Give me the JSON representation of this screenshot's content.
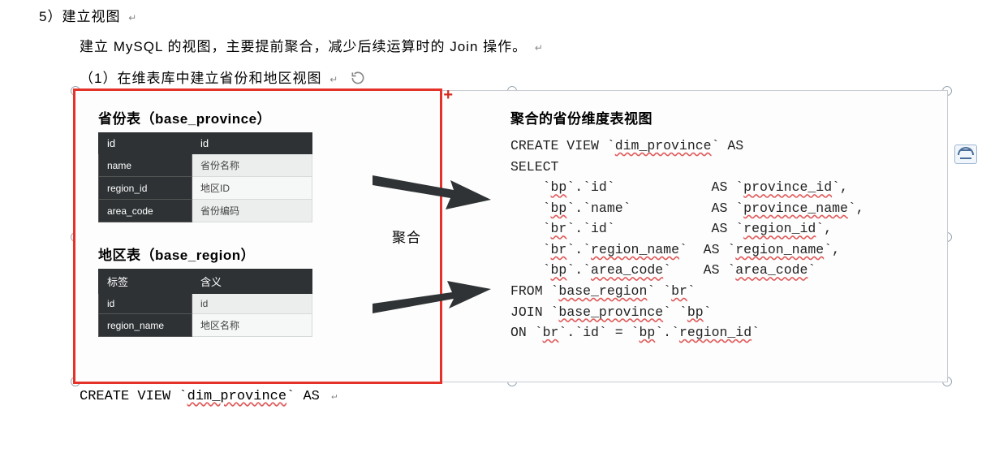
{
  "heading": "5）建立视图",
  "paragraph": "建立 MySQL 的视图，主要提前聚合，减少后续运算时的 Join 操作。",
  "subheading": "（1）在维表库中建立省份和地区视图",
  "left": {
    "table1": {
      "title_prefix": "省份表",
      "title_paren": "（base_province）",
      "header": [
        "id",
        "id"
      ],
      "rows": [
        {
          "label": "name",
          "value": "省份名称"
        },
        {
          "label": "region_id",
          "value": "地区ID"
        },
        {
          "label": "area_code",
          "value": "省份编码"
        }
      ]
    },
    "table2": {
      "title_prefix": "地区表",
      "title_paren": "（base_region）",
      "header": [
        "标签",
        "含义"
      ],
      "rows": [
        {
          "label": "id",
          "value": "id"
        },
        {
          "label": "region_name",
          "value": "地区名称"
        }
      ]
    },
    "mid_label": "聚合"
  },
  "right": {
    "title": "聚合的省份维度表视图",
    "sql": "CREATE VIEW `dim_province` AS\nSELECT\n    `bp`.`id`            AS `province_id`,\n    `bp`.`name`          AS `province_name`,\n    `br`.`id`            AS `region_id`,\n    `br`.`region_name`  AS `region_name`,\n    `bp`.`area_code`    AS `area_code`\nFROM `base_region` `br`\nJOIN `base_province` `bp`\nON `br`.`id` = `bp`.`region_id`"
  },
  "code_after": "CREATE VIEW `dim_province` AS ",
  "glyphs": {
    "return": "↵"
  }
}
